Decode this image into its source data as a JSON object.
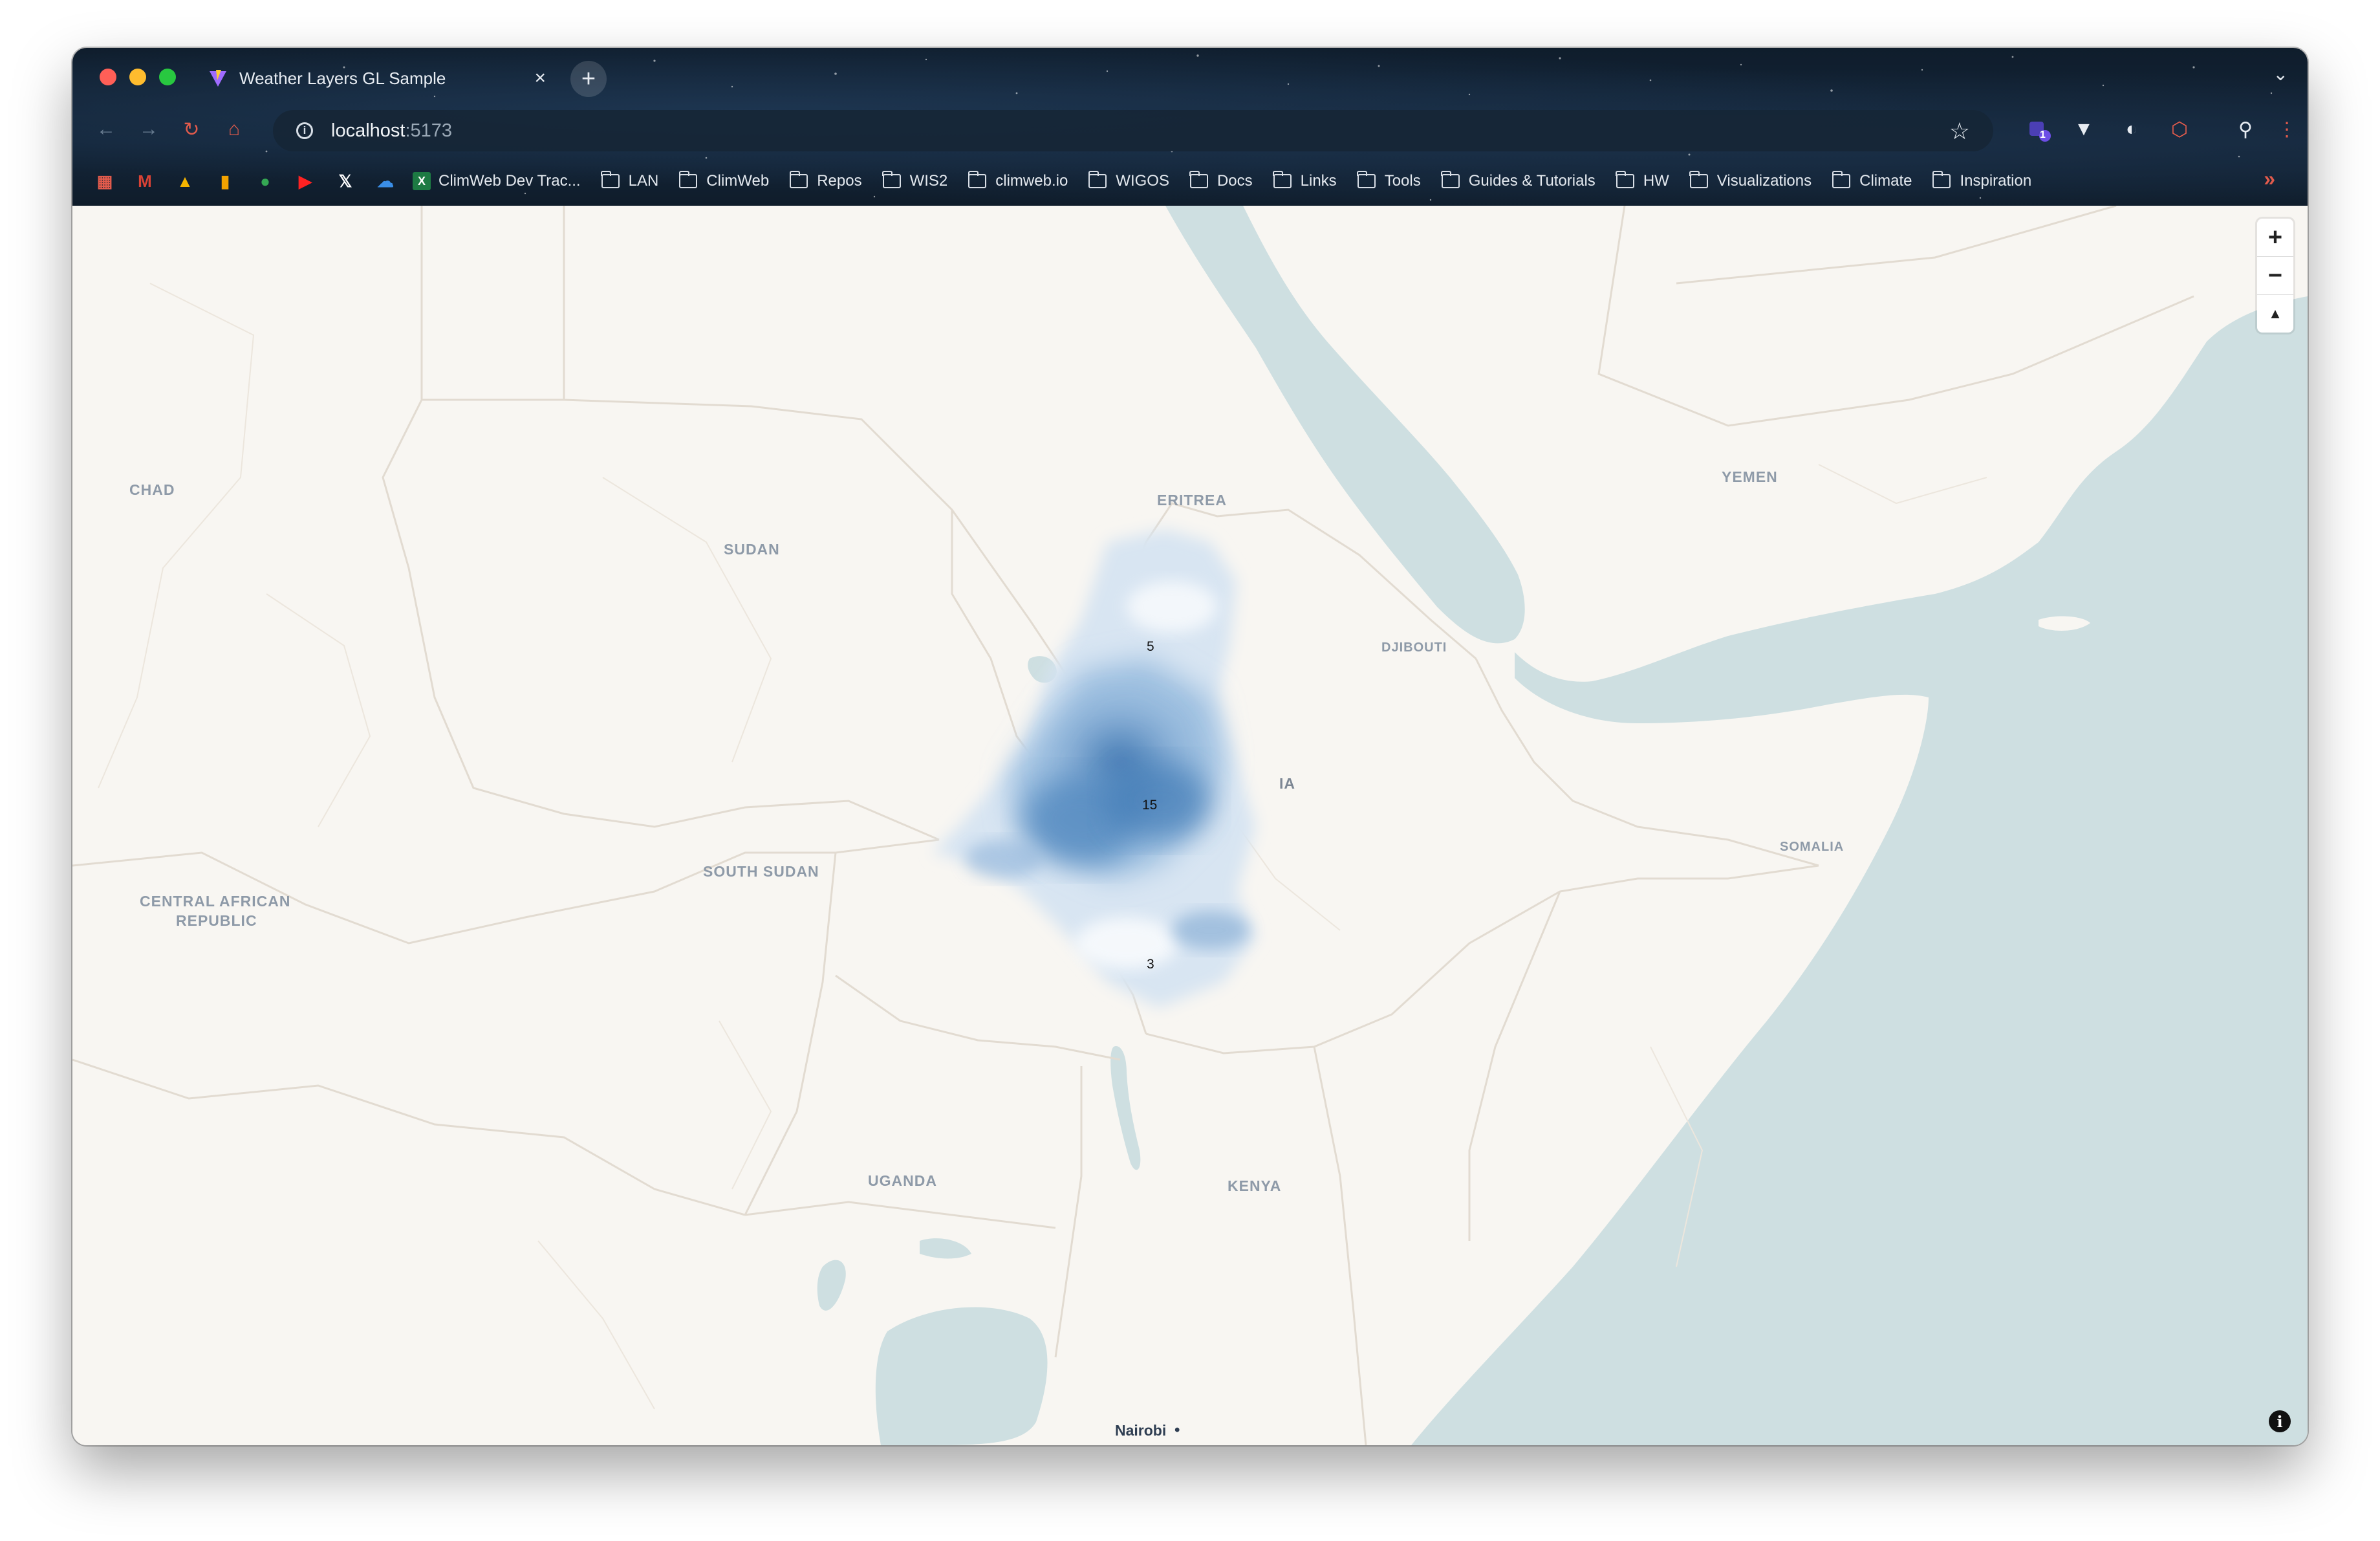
{
  "browser": {
    "tab": {
      "title": "Weather Layers GL Sample"
    },
    "new_tab_label": "+",
    "url": {
      "host": "localhost",
      "port": ":5173"
    },
    "bookmarks": [
      {
        "label": "ClimWeb Dev Trac...",
        "icon": "excel-sheet-icon"
      },
      {
        "label": "LAN",
        "icon": "folder-icon"
      },
      {
        "label": "ClimWeb",
        "icon": "folder-icon"
      },
      {
        "label": "Repos",
        "icon": "folder-icon"
      },
      {
        "label": "WIS2",
        "icon": "folder-icon"
      },
      {
        "label": "climweb.io",
        "icon": "folder-icon"
      },
      {
        "label": "WIGOS",
        "icon": "folder-icon"
      },
      {
        "label": "Docs",
        "icon": "folder-icon"
      },
      {
        "label": "Links",
        "icon": "folder-icon"
      },
      {
        "label": "Tools",
        "icon": "folder-icon"
      },
      {
        "label": "Guides & Tutorials",
        "icon": "folder-icon"
      },
      {
        "label": "HW",
        "icon": "folder-icon"
      },
      {
        "label": "Visualizations",
        "icon": "folder-icon"
      },
      {
        "label": "Climate",
        "icon": "folder-icon"
      },
      {
        "label": "Inspiration",
        "icon": "folder-icon"
      }
    ],
    "bookmarks_overflow": "»",
    "extension_badge": "1"
  },
  "map": {
    "countries": {
      "chad": "CHAD",
      "sudan": "SUDAN",
      "eritrea": "ERITREA",
      "yemen": "YEMEN",
      "djibouti": "DJIBOUTI",
      "somalia": "SOMALIA",
      "south_sudan": "SOUTH SUDAN",
      "car_line1": "CENTRAL AFRICAN",
      "car_line2": "REPUBLIC",
      "uganda": "UGANDA",
      "kenya": "KENYA",
      "ethiopia_partial": "IA"
    },
    "cities": {
      "nairobi": "Nairobi"
    },
    "contour_labels": {
      "north": "5",
      "center": "15",
      "south": "3"
    },
    "controls": {
      "zoom_in": "+",
      "zoom_out": "−",
      "compass": "▲",
      "attribution": "i"
    },
    "colors": {
      "land": "#f8f6f2",
      "water": "#cedfe1",
      "border": "#e3ddd4",
      "rain_dark": "#2f6fae",
      "rain_light": "#d8e6f3"
    }
  }
}
